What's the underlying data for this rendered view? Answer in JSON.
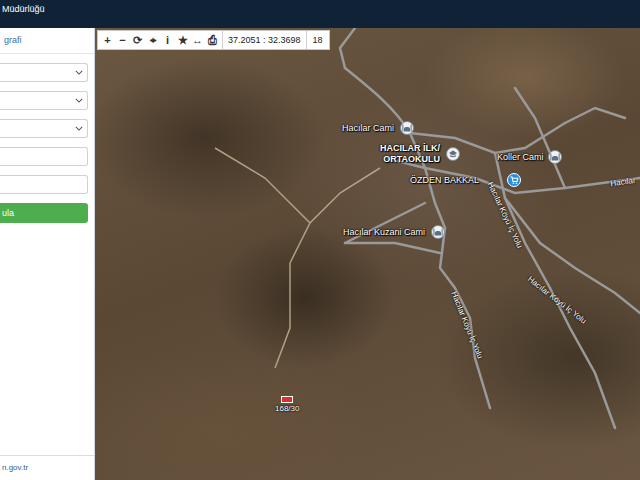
{
  "header": {
    "title": "Müdürlüğü"
  },
  "sidebar": {
    "tab": "grafi",
    "fields": [
      {
        "kind": "select"
      },
      {
        "kind": "select"
      },
      {
        "kind": "select"
      },
      {
        "kind": "input"
      },
      {
        "kind": "input"
      }
    ],
    "button": "ula",
    "footer": "n.gov.tr"
  },
  "toolbar": {
    "tools": [
      "+",
      "−",
      "⟳",
      "⌖",
      "i",
      "★",
      "↔",
      "⎙"
    ],
    "coordinates": "37.2051 : 32.3698",
    "zoom": "18"
  },
  "map": {
    "places": [
      {
        "label": "Hacılar Cami",
        "kind": "mosque"
      },
      {
        "label": "HACILAR İLK/ ORTAOKULU",
        "kind": "school"
      },
      {
        "label": "Koller Cami",
        "kind": "mosque"
      },
      {
        "label": "ÖZDEN BAKKAL",
        "kind": "shop"
      },
      {
        "label": "Hacılar Kuzani Cami",
        "kind": "mosque"
      }
    ],
    "roads": [
      {
        "label": "Hacılar Köyü İç Yolu"
      },
      {
        "label": "Hacılar Köyü İç Yolu"
      },
      {
        "label": "Hacılar Köyü İç Yolu"
      },
      {
        "label": "Hacılar"
      }
    ],
    "parcel": {
      "label": "168/30"
    }
  }
}
